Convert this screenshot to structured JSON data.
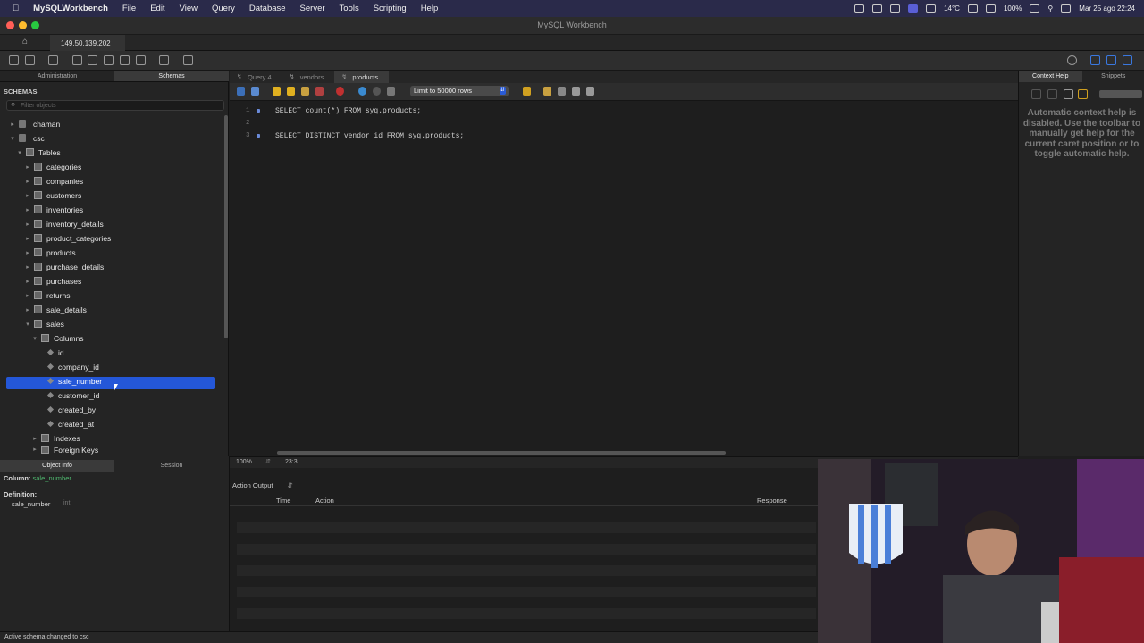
{
  "menubar": {
    "app_name": "MySQLWorkbench",
    "items": [
      "File",
      "Edit",
      "View",
      "Query",
      "Database",
      "Server",
      "Tools",
      "Scripting",
      "Help"
    ],
    "temperature": "14°C",
    "battery": "100%",
    "datetime": "Mar 25 ago  22:24"
  },
  "window": {
    "title": "MySQL Workbench"
  },
  "connection_tab": {
    "label": "149.50.139.202"
  },
  "left_panel": {
    "tabs": [
      "Administration",
      "Schemas"
    ],
    "section_title": "SCHEMAS",
    "filter_placeholder": "Filter objects",
    "tree": {
      "schema_chaman": "chaman",
      "schema_csc": "csc",
      "tables_folder": "Tables",
      "tables": [
        "categories",
        "companies",
        "customers",
        "inventories",
        "inventory_details",
        "product_categories",
        "products",
        "purchase_details",
        "purchases",
        "returns",
        "sale_details",
        "sales"
      ],
      "columns_folder": "Columns",
      "columns": [
        "id",
        "company_id",
        "sale_number",
        "customer_id",
        "created_by",
        "created_at"
      ],
      "indexes_folder": "Indexes",
      "foreign_keys_folder": "Foreign Keys"
    },
    "selected_column": "sale_number"
  },
  "editor": {
    "tabs": [
      "Query 4",
      "vendors",
      "products"
    ],
    "active_tab": "products",
    "limit_select": "Limit to 50000 rows",
    "lines": [
      {
        "num": "1",
        "text": "SELECT count(*) FROM syq.products;"
      },
      {
        "num": "2",
        "text": ""
      },
      {
        "num": "3",
        "text": "SELECT DISTINCT vendor_id FROM syq.products;"
      }
    ],
    "zoom": "100%",
    "caret_pos": "23:3"
  },
  "right_panel": {
    "tabs": [
      "Context Help",
      "Snippets"
    ],
    "help_text": "Automatic context help is disabled. Use the toolbar to manually get help for the current caret position or to toggle automatic help."
  },
  "object_info": {
    "tabs": [
      "Object Info",
      "Session"
    ],
    "column_label": "Column:",
    "column_value": "sale_number",
    "definition_label": "Definition:",
    "def_name": "sale_number",
    "def_type": "int"
  },
  "output": {
    "selector": "Action Output",
    "columns": [
      "Time",
      "Action",
      "Response"
    ]
  },
  "statusbar": {
    "message": "Active schema changed to csc"
  },
  "colors": {
    "selection": "#2457d8",
    "menubar": "#2a2a4a",
    "accent_text": "#4fb86f"
  }
}
